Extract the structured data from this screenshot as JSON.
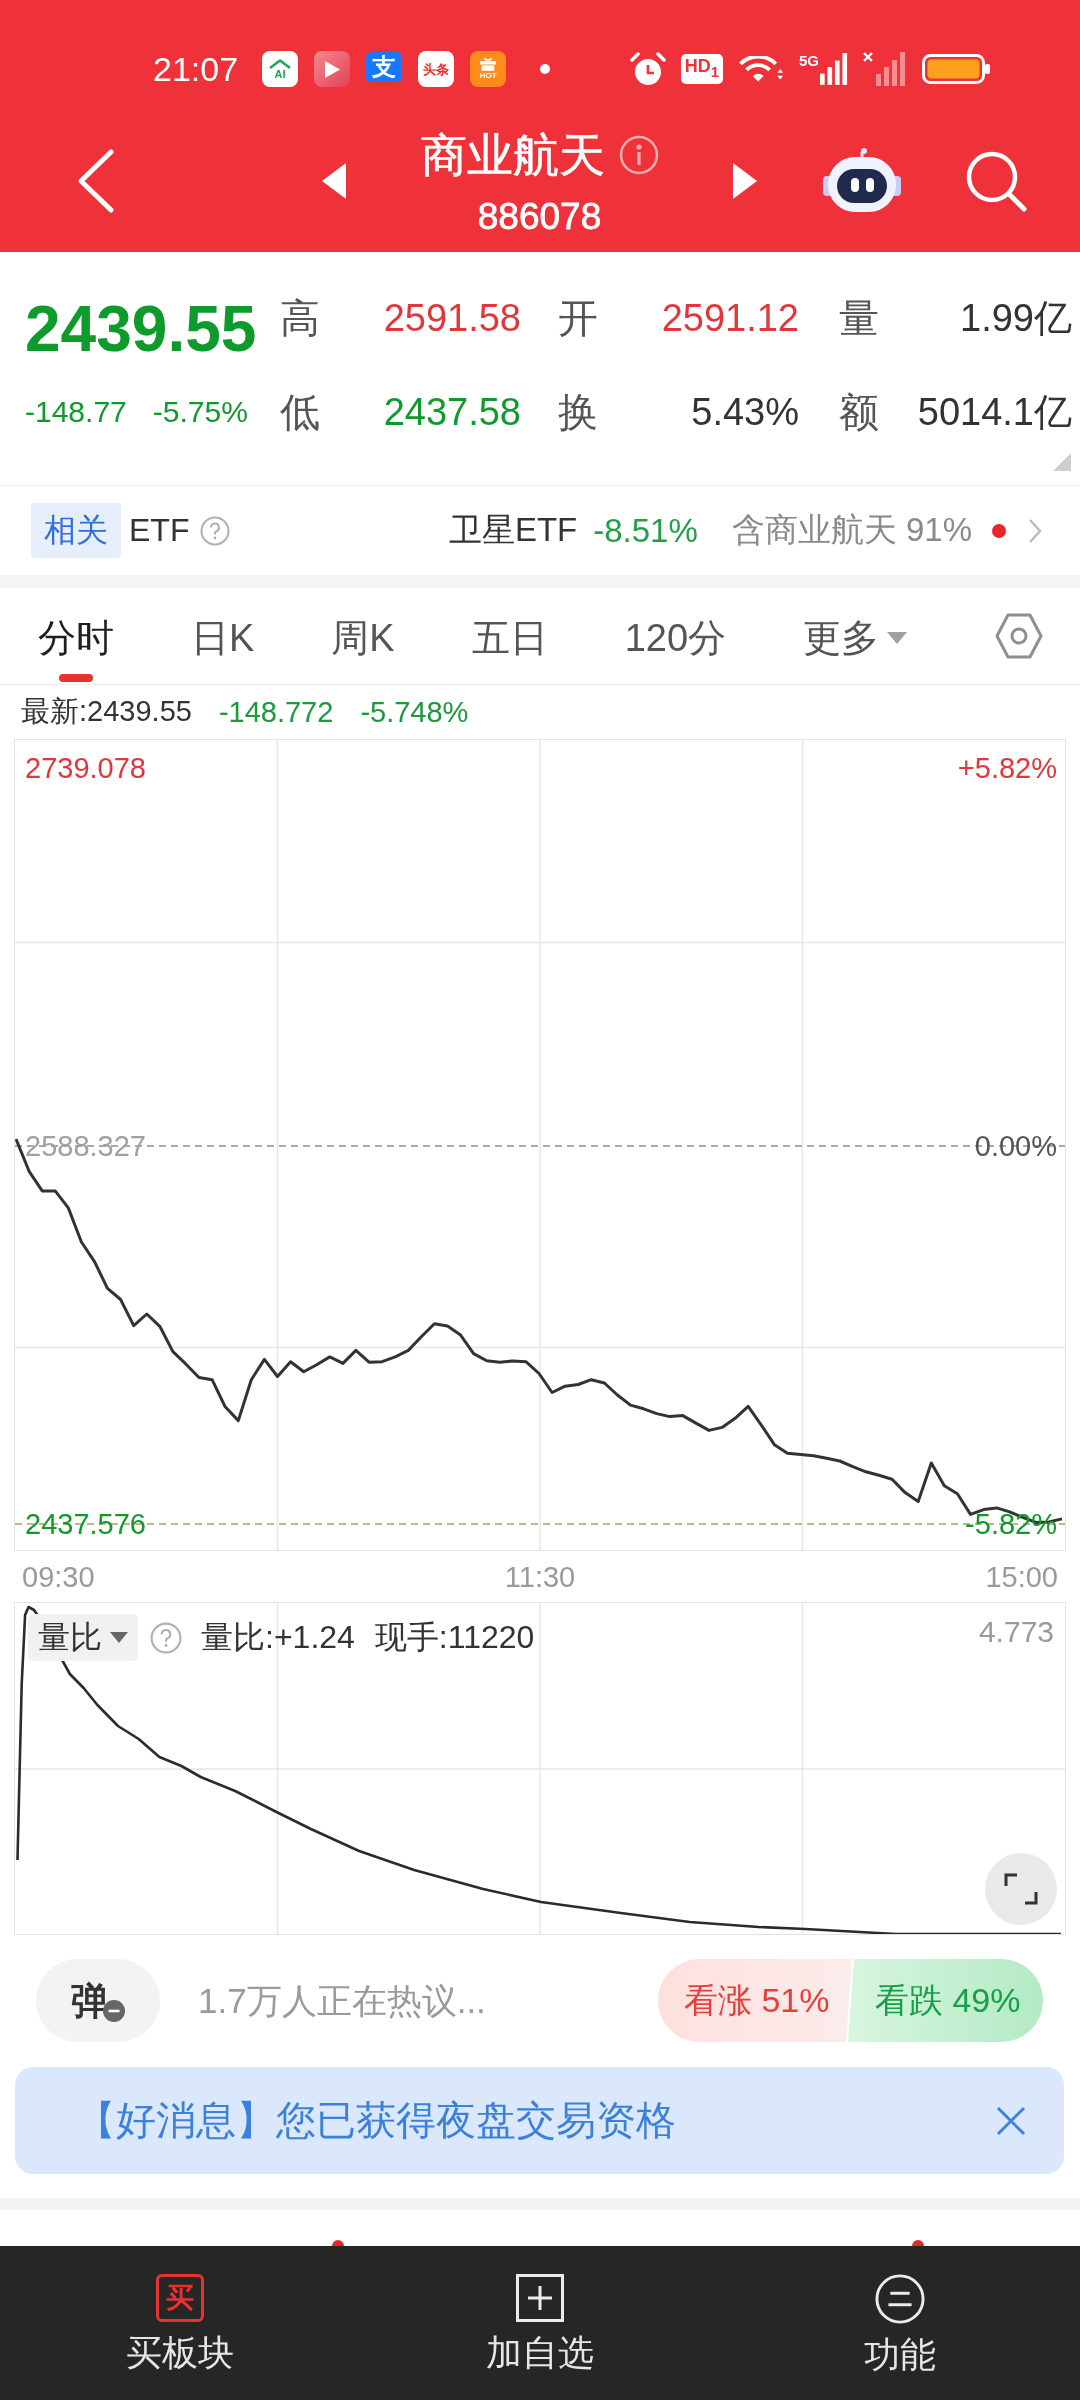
{
  "status_bar": {
    "time": "21:07",
    "app_icons": [
      {
        "kind": "house",
        "text": "AI"
      },
      {
        "kind": "play"
      },
      {
        "kind": "pay",
        "text": "支"
      },
      {
        "kind": "news",
        "text": "头条"
      },
      {
        "kind": "gift",
        "text": "HOT"
      }
    ],
    "hd_badge": "HD$_{1}$",
    "network": "5G"
  },
  "nav": {
    "title": "商业航天",
    "code": "886078"
  },
  "quote": {
    "price": "2439.55",
    "change": "-148.77",
    "change_pct": "-5.75%",
    "color": "#0f9a2c",
    "stat_rows": [
      [
        {
          "label": "高",
          "value": "2591.58",
          "color": "#e3363b"
        },
        {
          "label": "开",
          "value": "2591.12",
          "color": "#e3363b"
        },
        {
          "label": "量",
          "value": "1.99亿",
          "color": "#333333"
        }
      ],
      [
        {
          "label": "低",
          "value": "2437.58",
          "color": "#0f9a2c"
        },
        {
          "label": "换",
          "value": "5.43%",
          "color": "#333333"
        },
        {
          "label": "额",
          "value": "5014.1亿",
          "color": "#333333"
        }
      ]
    ]
  },
  "etf": {
    "tag": "相关",
    "label": "ETF",
    "fund": "卫星ETF",
    "fund_change": {
      "text": "-8.51%",
      "color": "#23a047"
    },
    "holding": "含商业航天 91%",
    "unread": true
  },
  "chart_tabs": [
    {
      "label": "分时",
      "selected": true,
      "dropdown": false
    },
    {
      "label": "日K",
      "selected": false,
      "dropdown": false
    },
    {
      "label": "周K",
      "selected": false,
      "dropdown": false
    },
    {
      "label": "五日",
      "selected": false,
      "dropdown": false
    },
    {
      "label": "120分",
      "selected": false,
      "dropdown": false
    },
    {
      "label": "更多",
      "selected": false,
      "dropdown": true
    }
  ],
  "latest": {
    "label": "最新:2439.55",
    "change": "-148.772",
    "change_pct": "-5.748%",
    "color": "#1a9a3a"
  },
  "price_chart": {
    "pct_labels": [
      {
        "text": "+5.82%",
        "color": "#e3363b"
      },
      {
        "text": "0.00%",
        "color": "#555555"
      },
      {
        "text": "-5.82%",
        "color": "#0f9a2c"
      }
    ],
    "chart_data": {
      "type": "line",
      "values": [
        2591.1,
        2578.2,
        2570.4,
        2570.4,
        2563.6,
        2550,
        2542.2,
        2531.5,
        2527.1,
        2516.7,
        2521.3,
        2516.4,
        2506.3,
        2501.3,
        2496,
        2495.1,
        2484.3,
        2478.8,
        2495.1,
        2503.2,
        2496.4,
        2502.3,
        2498.3,
        2501.1,
        2504.2,
        2501.6,
        2506.8,
        2502.1,
        2502.3,
        2504.2,
        2506.8,
        2512.2,
        2517.4,
        2516.5,
        2512.9,
        2505.5,
        2502.7,
        2502.1,
        2502.6,
        2502.3,
        2497.6,
        2490,
        2492.5,
        2493.2,
        2495.1,
        2493.8,
        2489,
        2485,
        2483.5,
        2481.6,
        2480.4,
        2480.8,
        2477.8,
        2474.9,
        2476.1,
        2479.7,
        2484.5,
        2477,
        2469.2,
        2465.8,
        2465.3,
        2464.8,
        2463.8,
        2462.7,
        2460.4,
        2458.4,
        2457,
        2455.4,
        2450.1,
        2446.5,
        2461.9,
        2452.8,
        2449.6,
        2441.4,
        2443.3,
        2444,
        2442.4,
        2440.2,
        2438.2,
        2438.4,
        2439.6
      ],
      "ylim": [
        2427.2,
        2750.2
      ],
      "yticks": [
        {
          "value": 2739.078,
          "label": "2739.078"
        },
        {
          "value": 2588.327,
          "label": "2588.327"
        },
        {
          "value": 2437.576,
          "label": "2437.576"
        }
      ],
      "ref_lines": [
        {
          "axis": "y",
          "value": 2588.327
        },
        {
          "axis": "y",
          "value": 2437.576
        }
      ],
      "grid": true
    },
    "time_labels": [
      "09:30",
      "11:30",
      "15:00"
    ]
  },
  "volume_pane": {
    "indicator": "量比",
    "ratio": "量比:+1.24",
    "hand": "现手:11220",
    "max": "4.773"
  },
  "sentiment": {
    "danmaku_label": "弹",
    "danmaku_on": false,
    "discussion": "1.7万人正在热议...",
    "votes": [
      {
        "kind": "bull",
        "text": "看涨 51%"
      },
      {
        "kind": "bear",
        "text": "看跌 49%"
      }
    ]
  },
  "notice": {
    "text": "【好消息】您已获得夜盘交易资格"
  },
  "bottom_nav": [
    {
      "kind": "buy",
      "icon_text": "买",
      "label": "买板块"
    },
    {
      "kind": "add",
      "label": "加自选"
    },
    {
      "kind": "menu",
      "label": "功能"
    }
  ]
}
